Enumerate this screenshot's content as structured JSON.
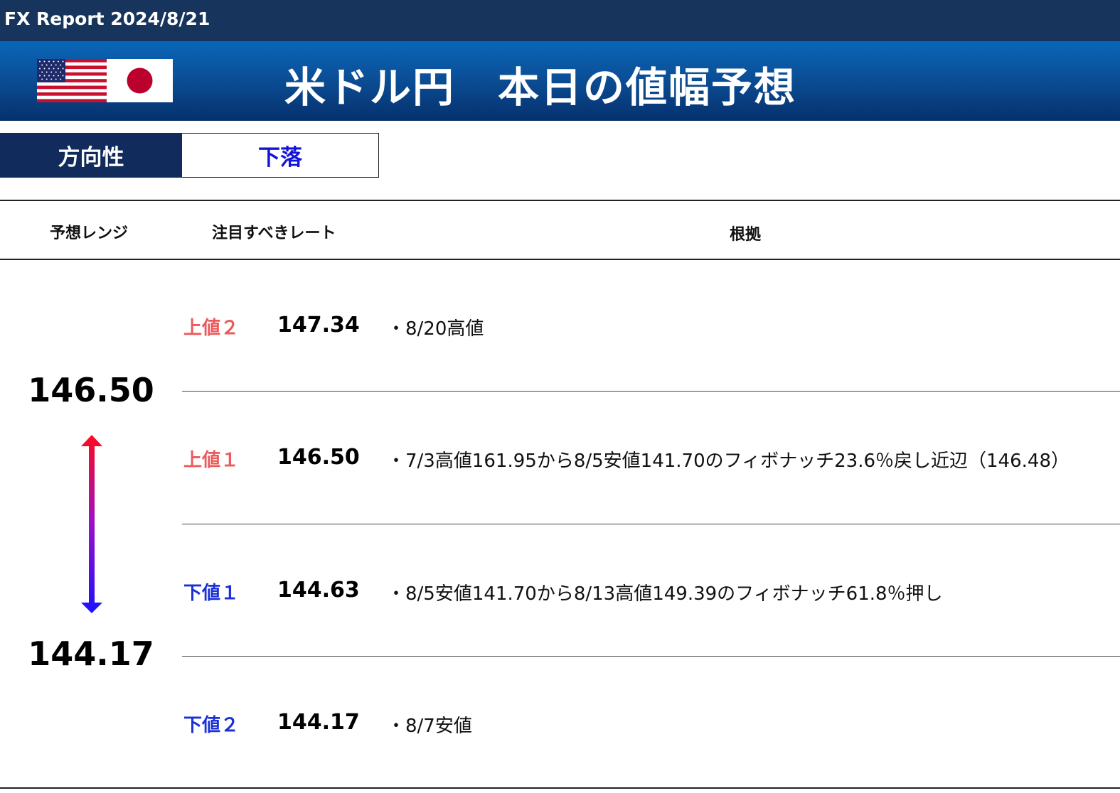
{
  "header": {
    "report_title": "FX Report 2024/8/21"
  },
  "banner": {
    "title": "米ドル円　本日の値幅予想",
    "flags": [
      "us-flag-icon",
      "jp-flag-icon"
    ]
  },
  "direction": {
    "label": "方向性",
    "value": "下落",
    "value_color": "#1414d8"
  },
  "columns": {
    "range": "予想レンジ",
    "rate": "注目すべきレート",
    "reason": "根拠"
  },
  "range": {
    "high": "146.50",
    "low": "144.17"
  },
  "levels": [
    {
      "label": "上値２",
      "rate": "147.34",
      "reason": "・8/20高値",
      "kind": "up"
    },
    {
      "label": "上値１",
      "rate": "146.50",
      "reason": "・7/3高値161.95から8/5安値141.70のフィボナッチ23.6％戻し近辺（146.48）",
      "kind": "up"
    },
    {
      "label": "下値１",
      "rate": "144.63",
      "reason": "・8/5安値141.70から8/13高値149.39のフィボナッチ61.8％押し",
      "kind": "down"
    },
    {
      "label": "下値２",
      "rate": "144.17",
      "reason": "・8/7安値",
      "kind": "down"
    }
  ],
  "colors": {
    "up": "#ee5a5a",
    "down": "#1a30d8",
    "navy": "#112b5c"
  }
}
